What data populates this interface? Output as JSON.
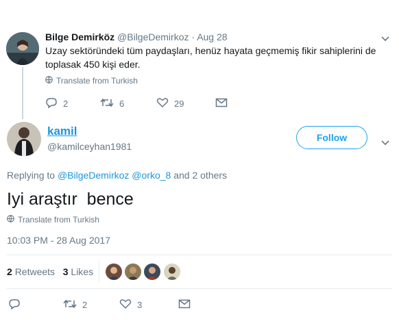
{
  "parent_tweet": {
    "name": "Bilge Demirköz",
    "handle": "@BilgeDemirkoz",
    "separator": "·",
    "date": "Aug 28",
    "text_line1": "Uzay sektöründeki tüm paydaşları, henüz hayata geçmemiş fikir sahiplerini de",
    "text_line2": "toplasak 450 kişi eder.",
    "translate": "Translate from Turkish",
    "replies": "2",
    "retweets": "6",
    "likes": "29"
  },
  "main_tweet": {
    "name": "kamil",
    "handle": "@kamilceyhan1981",
    "follow_label": "Follow",
    "replying_prefix": "Replying to",
    "replying_user1": "@BilgeDemirkoz",
    "replying_user2": "@orko_8",
    "replying_suffix": "and 2 others",
    "text": "Iyi araştır  bence",
    "translate": "Translate from Turkish",
    "timestamp": "10:03 PM - 28 Aug 2017",
    "retweet_count": "2",
    "retweet_label": "Retweets",
    "like_count": "3",
    "like_label": "Likes",
    "action_retweets": "2",
    "action_likes": "3"
  },
  "icons": [
    "reply-icon",
    "retweet-icon",
    "heart-icon",
    "mail-icon",
    "globe-icon",
    "chevron-down-icon"
  ],
  "colors": {
    "accent": "#1da1f2",
    "link": "#1b95e0",
    "muted": "#657786",
    "text": "#14171a"
  }
}
